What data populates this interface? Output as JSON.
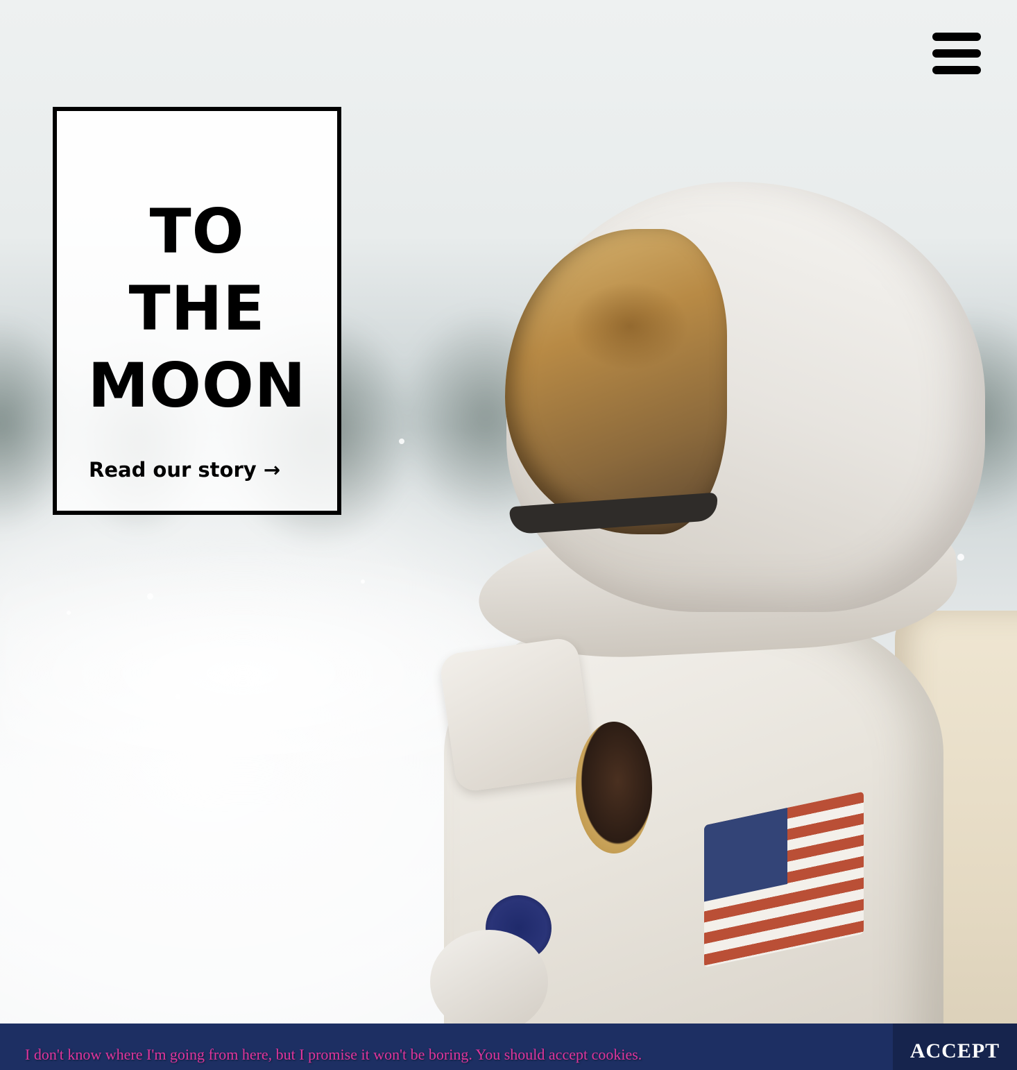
{
  "hero": {
    "image_icon": "astronaut-photo",
    "title_lines": [
      "TO",
      "THE",
      "MOON"
    ],
    "cta_label": "Read our story →"
  },
  "nav": {
    "menu_icon": "hamburger-menu-icon"
  },
  "cookie_banner": {
    "message": "I don't know where I'm going from here, but I promise it won't be boring. You should accept cookies.",
    "accept_label": "ACCEPT"
  },
  "colors": {
    "banner_background": "#1d2f63",
    "banner_text": "#e0359c",
    "accept_background": "#16244d",
    "card_border": "#000000"
  }
}
